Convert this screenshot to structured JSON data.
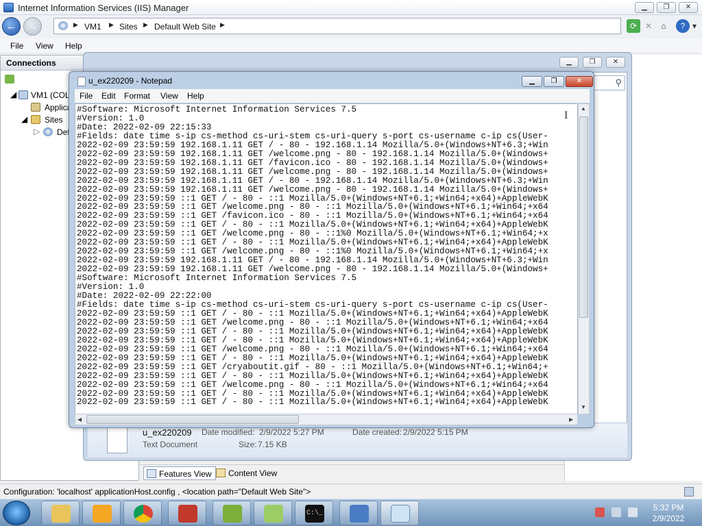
{
  "iis": {
    "title": "Internet Information Services (IIS) Manager",
    "breadcrumb": [
      "VM1",
      "Sites",
      "Default Web Site"
    ],
    "menu": [
      "File",
      "View",
      "Help"
    ],
    "connections_title": "Connections",
    "tree": [
      "VM1 (COL",
      "Applica",
      "Sites",
      "Def"
    ],
    "view_tabs": [
      "Features View",
      "Content View"
    ],
    "status": "Configuration: 'localhost' applicationHost.config , <location path=\"Default Web Site\">"
  },
  "explorer": {
    "file_name": "u_ex220209",
    "file_type": "Text Document",
    "date_modified_label": "Date modified:",
    "date_modified": "2/9/2022 5:27 PM",
    "date_created_label": "Date created:",
    "date_created": "2/9/2022 5:15 PM",
    "size_label": "Size:",
    "size": "7.15 KB"
  },
  "notepad": {
    "title": "u_ex220209 - Notepad",
    "menu": [
      "File",
      "Edit",
      "Format",
      "View",
      "Help"
    ],
    "lines": [
      "#Software: Microsoft Internet Information Services 7.5",
      "#Version: 1.0",
      "#Date: 2022-02-09 22:15:33",
      "#Fields: date time s-ip cs-method cs-uri-stem cs-uri-query s-port cs-username c-ip cs(User-",
      "2022-02-09 23:59:59 192.168.1.11 GET / - 80 - 192.168.1.14 Mozilla/5.0+(Windows+NT+6.3;+Win",
      "2022-02-09 23:59:59 192.168.1.11 GET /welcome.png - 80 - 192.168.1.14 Mozilla/5.0+(Windows+",
      "2022-02-09 23:59:59 192.168.1.11 GET /favicon.ico - 80 - 192.168.1.14 Mozilla/5.0+(Windows+",
      "2022-02-09 23:59:59 192.168.1.11 GET /welcome.png - 80 - 192.168.1.14 Mozilla/5.0+(Windows+",
      "2022-02-09 23:59:59 192.168.1.11 GET / - 80 - 192.168.1.14 Mozilla/5.0+(Windows+NT+6.3;+Win",
      "2022-02-09 23:59:59 192.168.1.11 GET /welcome.png - 80 - 192.168.1.14 Mozilla/5.0+(Windows+",
      "2022-02-09 23:59:59 ::1 GET / - 80 - ::1 Mozilla/5.0+(Windows+NT+6.1;+Win64;+x64)+AppleWebK",
      "2022-02-09 23:59:59 ::1 GET /welcome.png - 80 - ::1 Mozilla/5.0+(Windows+NT+6.1;+Win64;+x64",
      "2022-02-09 23:59:59 ::1 GET /favicon.ico - 80 - ::1 Mozilla/5.0+(Windows+NT+6.1;+Win64;+x64",
      "2022-02-09 23:59:59 ::1 GET / - 80 - ::1 Mozilla/5.0+(Windows+NT+6.1;+Win64;+x64)+AppleWebK",
      "2022-02-09 23:59:59 ::1 GET /welcome.png - 80 - ::1%0 Mozilla/5.0+(Windows+NT+6.1;+Win64;+x",
      "2022-02-09 23:59:59 ::1 GET / - 80 - ::1 Mozilla/5.0+(Windows+NT+6.1;+Win64;+x64)+AppleWebK",
      "2022-02-09 23:59:59 ::1 GET /welcome.png - 80 - ::1%0 Mozilla/5.0+(Windows+NT+6.1;+Win64;+x",
      "2022-02-09 23:59:59 192.168.1.11 GET / - 80 - 192.168.1.14 Mozilla/5.0+(Windows+NT+6.3;+Win",
      "2022-02-09 23:59:59 192.168.1.11 GET /welcome.png - 80 - 192.168.1.14 Mozilla/5.0+(Windows+",
      "#Software: Microsoft Internet Information Services 7.5",
      "#Version: 1.0",
      "#Date: 2022-02-09 22:22:00",
      "#Fields: date time s-ip cs-method cs-uri-stem cs-uri-query s-port cs-username c-ip cs(User-",
      "2022-02-09 23:59:59 ::1 GET / - 80 - ::1 Mozilla/5.0+(Windows+NT+6.1;+Win64;+x64)+AppleWebK",
      "2022-02-09 23:59:59 ::1 GET /welcome.png - 80 - ::1 Mozilla/5.0+(Windows+NT+6.1;+Win64;+x64",
      "2022-02-09 23:59:59 ::1 GET / - 80 - ::1 Mozilla/5.0+(Windows+NT+6.1;+Win64;+x64)+AppleWebK",
      "2022-02-09 23:59:59 ::1 GET / - 80 - ::1 Mozilla/5.0+(Windows+NT+6.1;+Win64;+x64)+AppleWebK",
      "2022-02-09 23:59:59 ::1 GET /welcome.png - 80 - ::1 Mozilla/5.0+(Windows+NT+6.1;+Win64;+x64",
      "2022-02-09 23:59:59 ::1 GET / - 80 - ::1 Mozilla/5.0+(Windows+NT+6.1;+Win64;+x64)+AppleWebK",
      "2022-02-09 23:59:59 ::1 GET /cryaboutit.gif - 80 - ::1 Mozilla/5.0+(Windows+NT+6.1;+Win64;+",
      "2022-02-09 23:59:59 ::1 GET / - 80 - ::1 Mozilla/5.0+(Windows+NT+6.1;+Win64;+x64)+AppleWebK",
      "2022-02-09 23:59:59 ::1 GET /welcome.png - 80 - ::1 Mozilla/5.0+(Windows+NT+6.1;+Win64;+x64",
      "2022-02-09 23:59:59 ::1 GET / - 80 - ::1 Mozilla/5.0+(Windows+NT+6.1;+Win64;+x64)+AppleWebK",
      "2022-02-09 23:59:59 ::1 GET / - 80 - ::1 Mozilla/5.0+(Windows+NT+6.1;+Win64;+x64)+AppleWebK"
    ]
  },
  "taskbar": {
    "time": "5:32 PM",
    "date": "2/9/2022",
    "apps": [
      "explorer-icon",
      "media-player-icon",
      "chrome-icon",
      "paint-icon",
      "app-icon",
      "notepad-plus-icon",
      "cmd-icon",
      "iis-icon",
      "notepad-icon"
    ]
  }
}
